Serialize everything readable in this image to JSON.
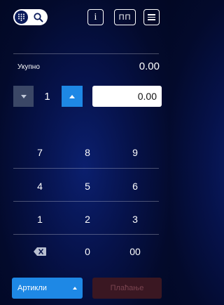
{
  "header": {
    "info_label": "i",
    "pp_label": "ПП",
    "icons": [
      "keypad-icon",
      "search-icon",
      "menu-icon"
    ]
  },
  "totals": {
    "label": "Укупно",
    "value": "0.00"
  },
  "quantity": {
    "value": "1"
  },
  "amount": {
    "value": "0.00"
  },
  "keypad": {
    "k7": "7",
    "k8": "8",
    "k9": "9",
    "k4": "4",
    "k5": "5",
    "k6": "6",
    "k1": "1",
    "k2": "2",
    "k3": "3",
    "k0": "0",
    "k00": "00"
  },
  "footer": {
    "articles_label": "Артикли",
    "pay_label": "Плаћање"
  },
  "colors": {
    "accent": "#1e88e5",
    "background": "#06124a",
    "pay_disabled_bg": "#3a1722",
    "pay_disabled_text": "#7a4450"
  }
}
